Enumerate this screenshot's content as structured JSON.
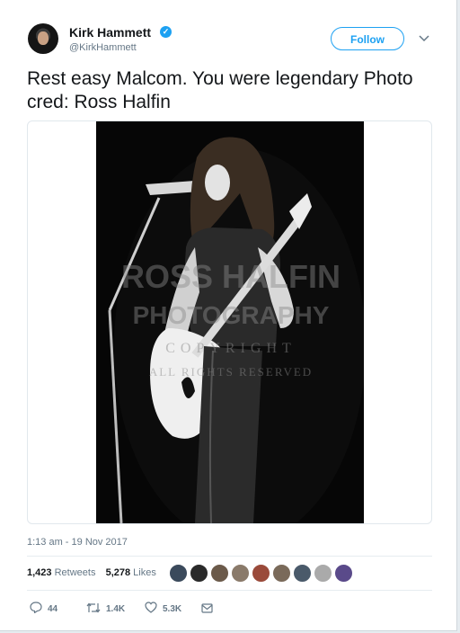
{
  "author": {
    "name": "Kirk Hammett",
    "handle": "@KirkHammett",
    "verified_mark": "✓"
  },
  "follow_label": "Follow",
  "tweet": {
    "text": "Rest easy Malcom. You were legendary Photo cred: Ross Halfin"
  },
  "photo": {
    "watermark_line1": "ROSS HALFIN",
    "watermark_line2": "PHOTOGRAPHY",
    "watermark_line3": "COPYRIGHT",
    "watermark_line4": "ALL RIGHTS RESERVED"
  },
  "timestamp": "1:13 am - 19 Nov 2017",
  "stats": {
    "retweets_count": "1,423",
    "retweets_label": "Retweets",
    "likes_count": "5,278",
    "likes_label": "Likes"
  },
  "liker_avatar_colors": [
    "#3b4a5c",
    "#2a2a2a",
    "#6b5a4a",
    "#8a7a6a",
    "#9a4a3a",
    "#7a6a5a",
    "#4a5a6a",
    "#aaaaaa",
    "#5a4a8a"
  ],
  "actions": {
    "reply_count": "44",
    "retweet_count": "1.4K",
    "like_count": "5.3K"
  },
  "colors": {
    "accent": "#1da1f2",
    "muted": "#657786",
    "text": "#14171a"
  }
}
